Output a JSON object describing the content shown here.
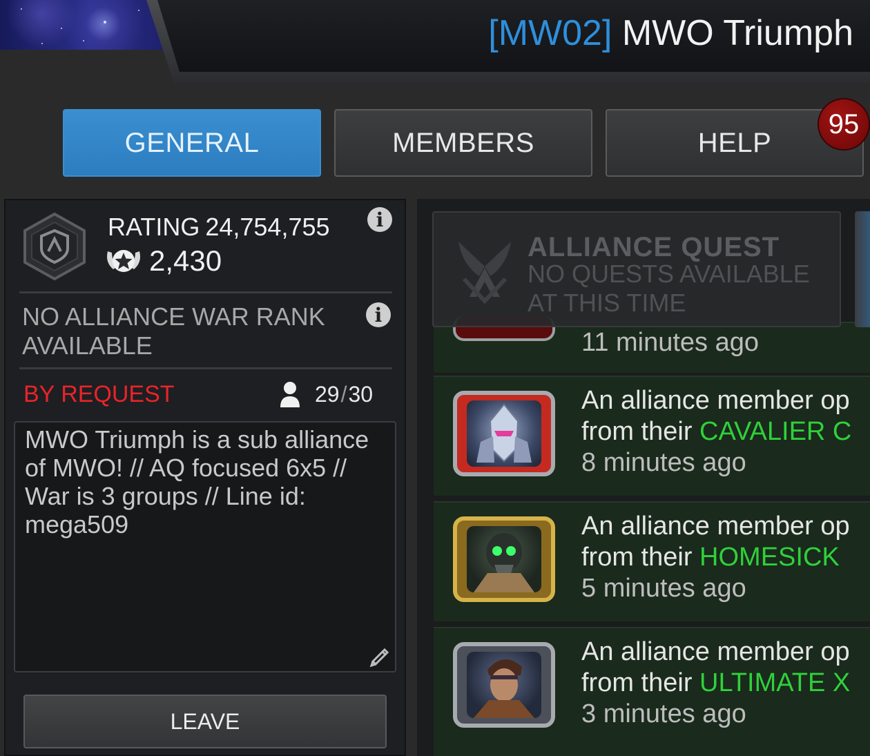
{
  "header": {
    "alliance_tag": "[MW02]",
    "alliance_name": "MWO Triumph"
  },
  "tabs": [
    {
      "label": "GENERAL",
      "active": true
    },
    {
      "label": "MEMBERS",
      "active": false
    },
    {
      "label": "HELP",
      "active": false
    }
  ],
  "help_badge": "95",
  "alliance": {
    "rating_label": "RATING",
    "rating_value": "24,754,755",
    "score": "2,430",
    "war_rank": "NO ALLIANCE WAR RANK AVAILABLE",
    "join_mode": "BY REQUEST",
    "members_current": "29",
    "members_separator": "/",
    "members_max": "30",
    "description": "MWO Triumph is a sub alliance of MWO! // AQ focused 6x5 // War is 3 groups  // Line id: mega509",
    "leave_label": "LEAVE"
  },
  "alliance_quest": {
    "title": "ALLIANCE QUEST",
    "subtitle_line1": "NO QUESTS AVAILABLE",
    "subtitle_line2": "AT THIS TIME"
  },
  "feed": [
    {
      "line1": "",
      "prefix": "",
      "gift": "",
      "time": "11 minutes ago"
    },
    {
      "line1": "An alliance member op",
      "prefix": "from their ",
      "gift": "CAVALIER C",
      "time": "8 minutes ago"
    },
    {
      "line1": "An alliance member op",
      "prefix": "from their ",
      "gift": "HOMESICK",
      "time": "5 minutes ago"
    },
    {
      "line1": "An alliance member op",
      "prefix": "from their ",
      "gift": "ULTIMATE X",
      "time": "3 minutes ago"
    }
  ],
  "colors": {
    "tag_blue": "#2e8fdc",
    "active_tab": "#3a8fd0",
    "request_red": "#e8242a",
    "gift_green": "#2fd13a",
    "badge_red": "#8e0c0c"
  }
}
